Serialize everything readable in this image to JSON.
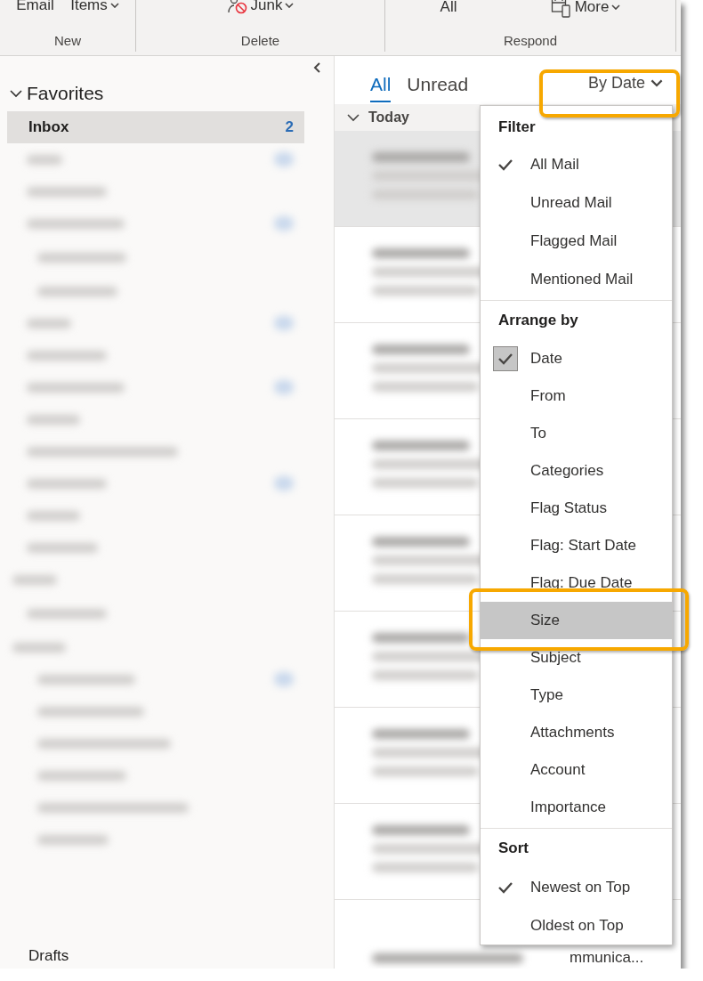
{
  "ribbon": {
    "groups": [
      {
        "label": "New",
        "buttons": [
          {
            "label": "Email",
            "dropdown": false
          },
          {
            "label": "Items",
            "dropdown": true
          }
        ]
      },
      {
        "label": "Delete",
        "buttons": [
          {
            "label": "Junk",
            "dropdown": true,
            "kind": "junk"
          }
        ]
      },
      {
        "label": "Respond",
        "buttons": [
          {
            "label": "All",
            "dropdown": false
          },
          {
            "label": "More",
            "dropdown": true,
            "kind": "meeting"
          }
        ]
      }
    ]
  },
  "sidebar": {
    "section": "Favorites",
    "expanded": true,
    "inbox": {
      "label": "Inbox",
      "count": "2",
      "selected": true
    },
    "bottom_item": "Drafts"
  },
  "message_list": {
    "tabs": [
      {
        "label": "All",
        "selected": true
      },
      {
        "label": "Unread",
        "selected": false
      }
    ],
    "sort_button": {
      "label": "By Date",
      "highlighted": true
    },
    "group_header": "Today",
    "last_row_text": "mmunica..."
  },
  "menu": {
    "sections": [
      {
        "title": "Filter",
        "items": [
          {
            "label": "All Mail",
            "checked": true,
            "highlighted": false
          },
          {
            "label": "Unread Mail",
            "checked": false,
            "highlighted": false
          },
          {
            "label": "Flagged Mail",
            "checked": false,
            "highlighted": false
          },
          {
            "label": "Mentioned Mail",
            "checked": false,
            "highlighted": false
          }
        ]
      },
      {
        "title": "Arrange by",
        "items": [
          {
            "label": "Date",
            "checked": true,
            "highlighted": false
          },
          {
            "label": "From",
            "checked": false,
            "highlighted": false
          },
          {
            "label": "To",
            "checked": false,
            "highlighted": false
          },
          {
            "label": "Categories",
            "checked": false,
            "highlighted": false
          },
          {
            "label": "Flag Status",
            "checked": false,
            "highlighted": false
          },
          {
            "label": "Flag: Start Date",
            "checked": false,
            "highlighted": false
          },
          {
            "label": "Flag: Due Date",
            "checked": false,
            "highlighted": false
          },
          {
            "label": "Size",
            "checked": false,
            "highlighted": true
          },
          {
            "label": "Subject",
            "checked": false,
            "highlighted": false
          },
          {
            "label": "Type",
            "checked": false,
            "highlighted": false
          },
          {
            "label": "Attachments",
            "checked": false,
            "highlighted": false
          },
          {
            "label": "Account",
            "checked": false,
            "highlighted": false
          },
          {
            "label": "Importance",
            "checked": false,
            "highlighted": false
          }
        ]
      },
      {
        "title": "Sort",
        "items": [
          {
            "label": "Newest on Top",
            "checked": true,
            "highlighted": false
          },
          {
            "label": "Oldest on Top",
            "checked": false,
            "highlighted": false
          }
        ]
      }
    ]
  }
}
